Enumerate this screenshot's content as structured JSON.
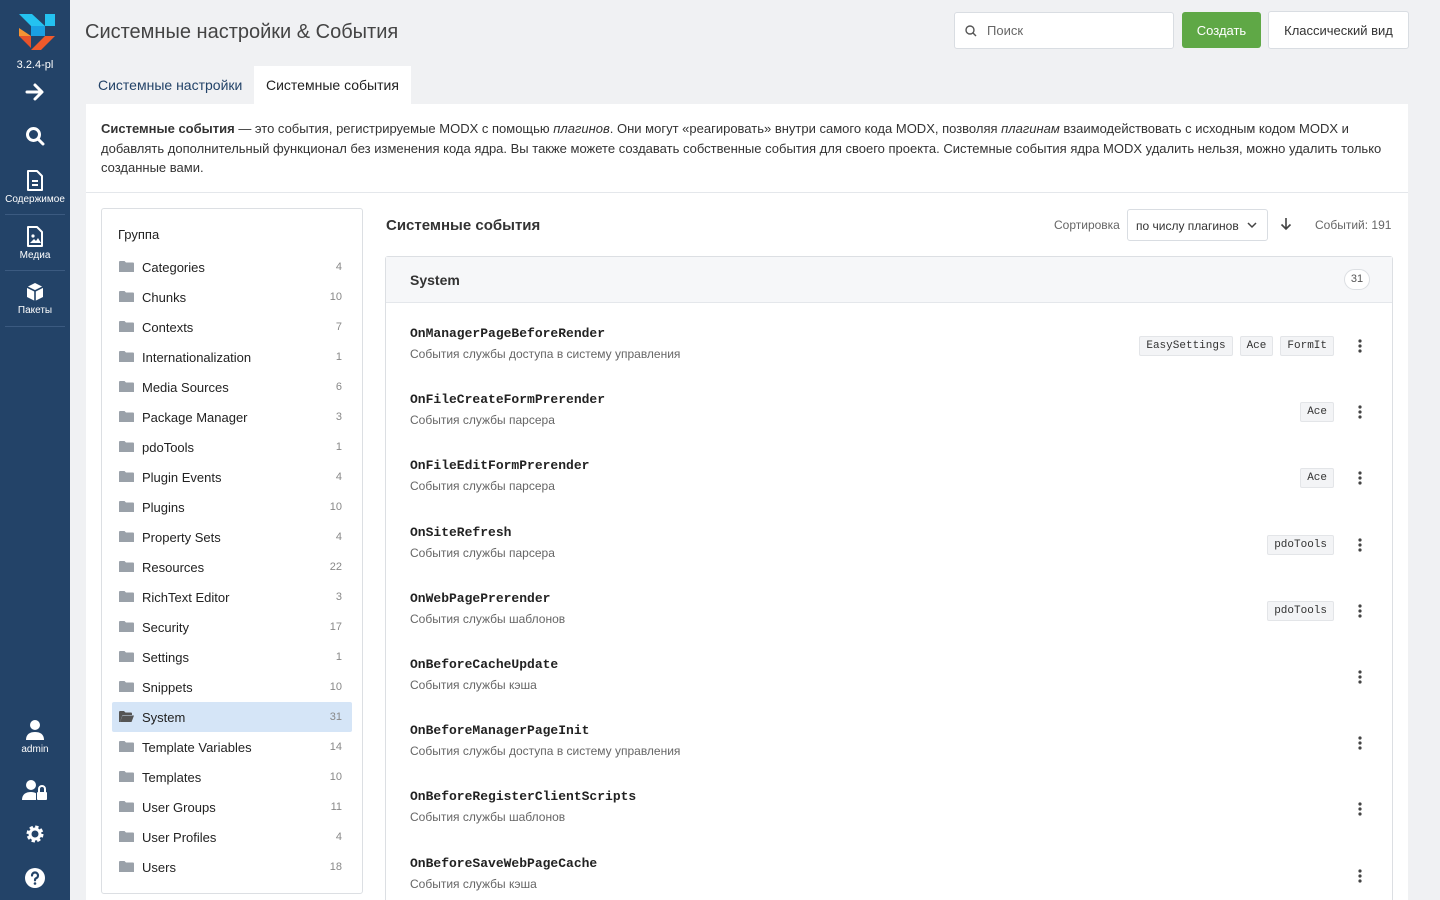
{
  "rail": {
    "version": "3.2.4-pl",
    "items": [
      {
        "icon": "arrow-right-icon",
        "label": ""
      },
      {
        "icon": "search-icon",
        "label": ""
      },
      {
        "icon": "content-icon",
        "label": "Содержимое"
      },
      {
        "icon": "media-icon",
        "label": "Медиа"
      },
      {
        "icon": "package-icon",
        "label": "Пакеты"
      }
    ],
    "bottom": [
      {
        "icon": "user-icon",
        "label": "admin"
      },
      {
        "icon": "user-lock-icon",
        "label": ""
      },
      {
        "icon": "gear-icon",
        "label": ""
      },
      {
        "icon": "help-icon",
        "label": ""
      }
    ]
  },
  "header": {
    "title": "Системные настройки & События",
    "search_placeholder": "Поиск",
    "create_label": "Создать",
    "classic_label": "Классический вид"
  },
  "tabs": [
    {
      "label": "Системные настройки",
      "active": false
    },
    {
      "label": "Системные события",
      "active": true
    }
  ],
  "intro": {
    "bold": "Системные события",
    "part1": " — это события, регистрируемые MODX с помощью ",
    "em1": "плагинов",
    "part2": ". Они могут «реагировать» внутри самого кода MODX, позволяя ",
    "em2": "плагинам",
    "part3": " взаимодействовать с исходным кодом MODX и добавлять дополнительный функционал без изменения кода ядра. Вы также можете создавать собственные события для своего проекта. Системные события ядра MODX удалить нельзя, можно удалить только созданные вами."
  },
  "groups": {
    "title": "Группа",
    "items": [
      {
        "name": "Categories",
        "count": "4"
      },
      {
        "name": "Chunks",
        "count": "10"
      },
      {
        "name": "Contexts",
        "count": "7"
      },
      {
        "name": "Internationalization",
        "count": "1"
      },
      {
        "name": "Media Sources",
        "count": "6"
      },
      {
        "name": "Package Manager",
        "count": "3"
      },
      {
        "name": "pdoTools",
        "count": "1"
      },
      {
        "name": "Plugin Events",
        "count": "4"
      },
      {
        "name": "Plugins",
        "count": "10"
      },
      {
        "name": "Property Sets",
        "count": "4"
      },
      {
        "name": "Resources",
        "count": "22"
      },
      {
        "name": "RichText Editor",
        "count": "3"
      },
      {
        "name": "Security",
        "count": "17"
      },
      {
        "name": "Settings",
        "count": "1"
      },
      {
        "name": "Snippets",
        "count": "10"
      },
      {
        "name": "System",
        "count": "31",
        "active": true
      },
      {
        "name": "Template Variables",
        "count": "14"
      },
      {
        "name": "Templates",
        "count": "10"
      },
      {
        "name": "User Groups",
        "count": "11"
      },
      {
        "name": "User Profiles",
        "count": "4"
      },
      {
        "name": "Users",
        "count": "18"
      }
    ]
  },
  "events": {
    "title": "Системные события",
    "sort_label": "Сортировка",
    "sort_value": "по числу плагинов",
    "count_text": "Событий: 191",
    "group_name": "System",
    "group_count": "31",
    "rows": [
      {
        "name": "OnManagerPageBeforeRender",
        "desc": "События службы доступа в систему управления",
        "tags": [
          "EasySettings",
          "Ace",
          "FormIt"
        ]
      },
      {
        "name": "OnFileCreateFormPrerender",
        "desc": "События службы парсера",
        "tags": [
          "Ace"
        ]
      },
      {
        "name": "OnFileEditFormPrerender",
        "desc": "События службы парсера",
        "tags": [
          "Ace"
        ]
      },
      {
        "name": "OnSiteRefresh",
        "desc": "События службы парсера",
        "tags": [
          "pdoTools"
        ]
      },
      {
        "name": "OnWebPagePrerender",
        "desc": "События службы шаблонов",
        "tags": [
          "pdoTools"
        ]
      },
      {
        "name": "OnBeforeCacheUpdate",
        "desc": "События службы кэша",
        "tags": []
      },
      {
        "name": "OnBeforeManagerPageInit",
        "desc": "События службы доступа в систему управления",
        "tags": []
      },
      {
        "name": "OnBeforeRegisterClientScripts",
        "desc": "События службы шаблонов",
        "tags": []
      },
      {
        "name": "OnBeforeSaveWebPageCache",
        "desc": "События службы кэша",
        "tags": []
      }
    ]
  },
  "colors": {
    "rail": "#234368",
    "accent_green": "#5fa846",
    "active_group": "#d5e5f7"
  }
}
